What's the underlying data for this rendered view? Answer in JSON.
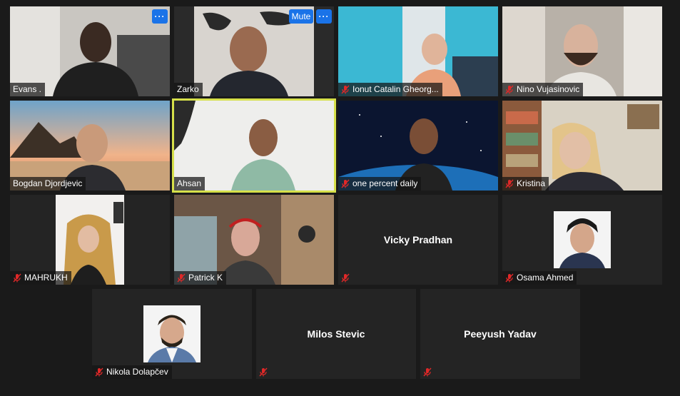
{
  "controls": {
    "mute_label": "Mute",
    "more_label": "···"
  },
  "participants": [
    {
      "name": "Evans .",
      "muted": false
    },
    {
      "name": "Zarko",
      "muted": false
    },
    {
      "name": "Ionut Catalin Gheorg...",
      "muted": true
    },
    {
      "name": "Nino Vujasinovic",
      "muted": true
    },
    {
      "name": "Bogdan Djordjevic",
      "muted": false
    },
    {
      "name": "Ahsan",
      "muted": false,
      "speaking": true
    },
    {
      "name": "one percent daily",
      "muted": true
    },
    {
      "name": "Kristina",
      "muted": true
    },
    {
      "name": "MAHRUKH",
      "muted": true
    },
    {
      "name": "Patrick K",
      "muted": true
    },
    {
      "name": "",
      "display_name": "Vicky Pradhan",
      "muted": true,
      "video": false
    },
    {
      "name": "Osama Ahmed",
      "muted": true,
      "photo": true
    },
    {
      "name": "Nikola Dolapčev",
      "muted": true,
      "photo": true
    },
    {
      "name": "",
      "display_name": "Milos Stevic",
      "muted": true,
      "video": false
    },
    {
      "name": "",
      "display_name": "Peeyush Yadav",
      "muted": true,
      "video": false
    }
  ]
}
